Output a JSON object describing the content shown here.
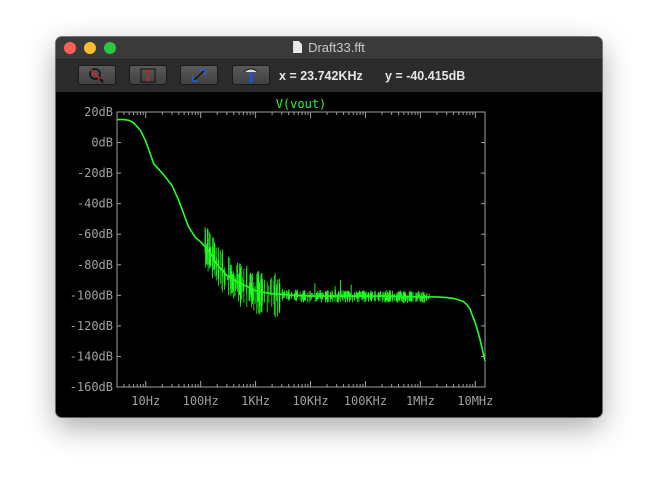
{
  "window": {
    "title": "Draft33.fft"
  },
  "toolbar": {
    "buttons": [
      {
        "icon": "zoom-cancel-icon"
      },
      {
        "icon": "autorange-y-icon"
      },
      {
        "icon": "pan-icon"
      },
      {
        "icon": "probe-icon"
      }
    ],
    "cursor_x": "x = 23.742KHz",
    "cursor_y": "y = -40.415dB"
  },
  "colors": {
    "trace": "#22ff22",
    "axes": "#a0a0a0",
    "background": "#000000"
  },
  "chart_data": {
    "type": "line",
    "title": "V(vout)",
    "xlabel": "",
    "ylabel": "",
    "x_scale": "log",
    "xlim": [
      3,
      15000000
    ],
    "ylim": [
      -160,
      20
    ],
    "grid": false,
    "x_ticks": [
      {
        "value": 10,
        "label": "10Hz"
      },
      {
        "value": 100,
        "label": "100Hz"
      },
      {
        "value": 1000,
        "label": "1KHz"
      },
      {
        "value": 10000,
        "label": "10KHz"
      },
      {
        "value": 100000,
        "label": "100KHz"
      },
      {
        "value": 1000000,
        "label": "1MHz"
      },
      {
        "value": 10000000,
        "label": "10MHz"
      }
    ],
    "y_ticks": [
      {
        "value": 20,
        "label": "20dB"
      },
      {
        "value": 0,
        "label": "0dB"
      },
      {
        "value": -20,
        "label": "-20dB"
      },
      {
        "value": -40,
        "label": "-40dB"
      },
      {
        "value": -60,
        "label": "-60dB"
      },
      {
        "value": -80,
        "label": "-80dB"
      },
      {
        "value": -100,
        "label": "-100dB"
      },
      {
        "value": -120,
        "label": "-120dB"
      },
      {
        "value": -140,
        "label": "-140dB"
      },
      {
        "value": -160,
        "label": "-160dB"
      }
    ],
    "series": [
      {
        "name": "V(vout)",
        "x": [
          3,
          4,
          5,
          6,
          8,
          10,
          14,
          20,
          30,
          40,
          60,
          80,
          100,
          150,
          200,
          300,
          500,
          800,
          1000,
          2000,
          5000,
          10000,
          30000,
          100000,
          300000,
          1000000,
          2000000,
          3000000,
          4000000,
          5000000,
          6000000,
          7000000,
          8000000,
          9000000,
          10000000,
          12000000,
          15000000
        ],
        "y": [
          15,
          15,
          14.5,
          13,
          8,
          1,
          -14,
          -20,
          -28,
          -38,
          -55,
          -62,
          -65,
          -72,
          -80,
          -87,
          -92,
          -95,
          -97,
          -99,
          -100,
          -100.5,
          -100.5,
          -100.5,
          -100.5,
          -101,
          -101,
          -101.5,
          -102,
          -103,
          -104,
          -106,
          -109,
          -114,
          -118,
          -128,
          -143
        ]
      }
    ]
  }
}
